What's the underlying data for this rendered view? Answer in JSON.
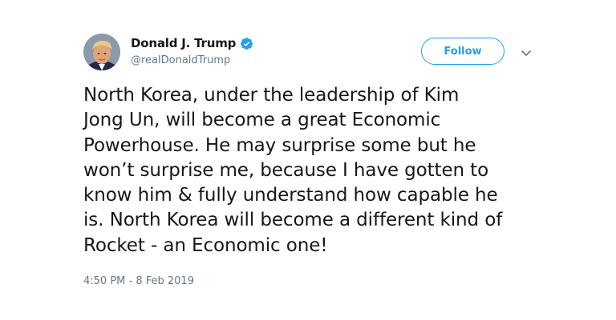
{
  "author": {
    "display_name": "Donald J. Trump",
    "handle": "@realDonaldTrump",
    "verified": true
  },
  "actions": {
    "follow_label": "Follow"
  },
  "tweet": {
    "text": "North Korea, under the leadership of Kim\nJong Un, will become a great Economic\nPowerhouse. He may surprise some but he\nwon’t surprise me, because I have gotten to\nknow him & fully understand how capable he\nis. North Korea will become a different kind of\nRocket - an Economic one!",
    "timestamp": "4:50 PM - 8 Feb 2019"
  },
  "icons": {
    "verified": "verified-badge-icon",
    "caret": "chevron-down-icon",
    "avatar": "profile-avatar"
  },
  "colors": {
    "accent": "#1da1f2",
    "text": "#14171a",
    "muted": "#657786"
  }
}
